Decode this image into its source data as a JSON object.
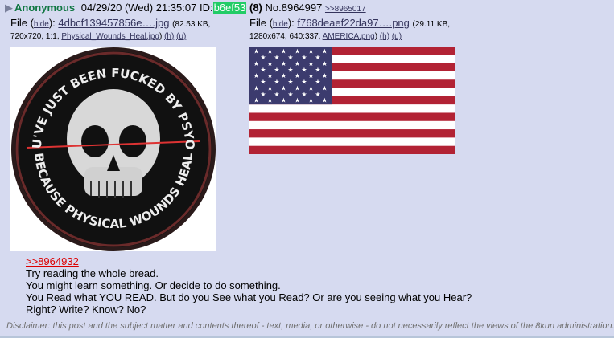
{
  "post": {
    "arrow": "▶",
    "name": "Anonymous",
    "datetime": "04/29/20 (Wed) 21:35:07",
    "id_label": "ID:",
    "id_value": "b6ef53",
    "id_count": "(8)",
    "post_number": "No.8964997",
    "backlink": ">>8965017"
  },
  "files": [
    {
      "label": "File",
      "hide": "hide",
      "filename": "4dbcf139457856e….jpg",
      "size": "82.53 KB,",
      "dims": "720x720, 1:1,",
      "original_name": "Physical_Wounds_Heal.jpg",
      "h": "(h)",
      "u": "(u)"
    },
    {
      "label": "File",
      "hide": "hide",
      "filename": "f768deaef22da97….png",
      "size": "29.11 KB,",
      "dims": "1280x674, 640:337,",
      "original_name": "AMERICA.png",
      "h": "(h)",
      "u": "(u)"
    }
  ],
  "skull_patch": {
    "text_top": "YOU'VE JUST BEEN FUCKED BY PSYOPS",
    "text_bottom": "BECAUSE PHYSICAL WOUNDS HEAL"
  },
  "body": {
    "quote_link": ">>8964932",
    "lines": [
      "Try reading the whole bread.",
      "You might learn something. Or decide to do something.",
      "You Read what YOU READ. But do you See what you Read? Or are you seeing what you Hear?",
      "Right? Write? Know? No?"
    ]
  },
  "disclaimer": "Disclaimer: this post and the subject matter and contents thereof - text, media, or otherwise - do not necessarily reflect the views of the 8kun administration.",
  "colors": {
    "background": "#d6daf0",
    "name": "#117743",
    "id_badge": "#22cc66",
    "link": "#34345c",
    "quote": "#dd0000",
    "flag_red": "#b22234",
    "flag_blue": "#3c3b6e"
  }
}
